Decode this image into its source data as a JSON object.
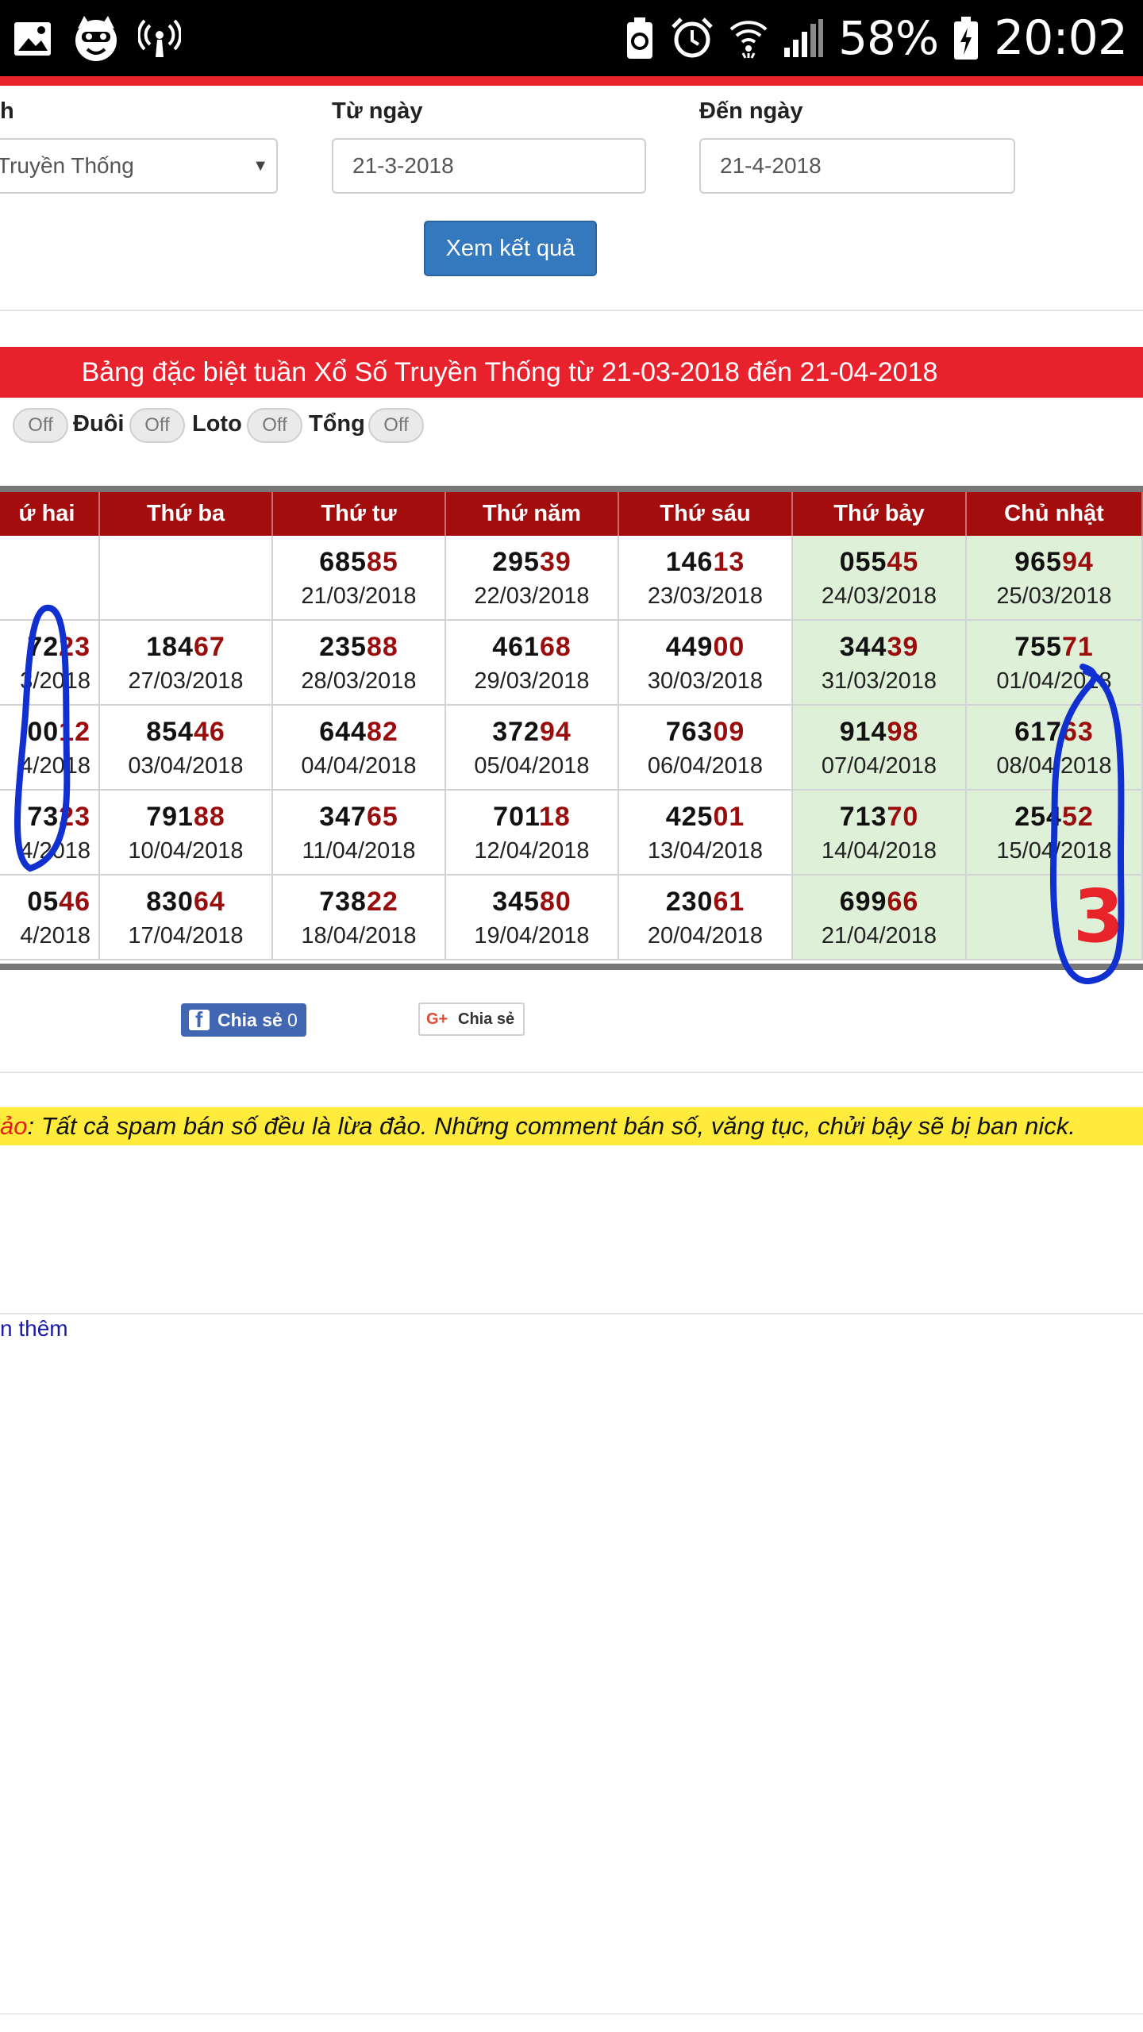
{
  "status_bar": {
    "battery_percent": "58%",
    "time": "20:02",
    "left_icons": [
      "gallery-icon",
      "cat-app-icon",
      "hotspot-icon"
    ],
    "right_icons": [
      "battery-saver-icon",
      "alarm-icon",
      "wifi-icon",
      "signal-icon",
      "battery-icon"
    ]
  },
  "form": {
    "type_label": "h",
    "type_value": "Truyền Thống",
    "from_label": "Từ ngày",
    "from_value": "21-3-2018",
    "to_label": "Đến ngày",
    "to_value": "21-4-2018",
    "submit_label": "Xem kết quả"
  },
  "banner": {
    "title": "Bảng đặc biệt tuần Xổ Số Truyền Thống từ 21-03-2018 đến 21-04-2018"
  },
  "toggles": [
    {
      "label": "",
      "state": "Off"
    },
    {
      "label": "Đuôi",
      "state": "Off"
    },
    {
      "label": "Loto",
      "state": "Off"
    },
    {
      "label": "Tổng",
      "state": "Off"
    }
  ],
  "table": {
    "headers": [
      "ứ hai",
      "Thứ ba",
      "Thứ tư",
      "Thứ năm",
      "Thứ sáu",
      "Thứ bảy",
      "Chủ nhật"
    ],
    "rows": [
      [
        {
          "head": "",
          "tail": "",
          "date": ""
        },
        {
          "head": "",
          "tail": "",
          "date": ""
        },
        {
          "head": "685",
          "tail": "85",
          "date": "21/03/2018"
        },
        {
          "head": "295",
          "tail": "39",
          "date": "22/03/2018"
        },
        {
          "head": "146",
          "tail": "13",
          "date": "23/03/2018"
        },
        {
          "head": "055",
          "tail": "45",
          "date": "24/03/2018"
        },
        {
          "head": "965",
          "tail": "94",
          "date": "25/03/2018"
        }
      ],
      [
        {
          "head": "72",
          "tail": "23",
          "date": "3/2018"
        },
        {
          "head": "184",
          "tail": "67",
          "date": "27/03/2018"
        },
        {
          "head": "235",
          "tail": "88",
          "date": "28/03/2018"
        },
        {
          "head": "461",
          "tail": "68",
          "date": "29/03/2018"
        },
        {
          "head": "449",
          "tail": "00",
          "date": "30/03/2018"
        },
        {
          "head": "344",
          "tail": "39",
          "date": "31/03/2018"
        },
        {
          "head": "755",
          "tail": "71",
          "date": "01/04/2018"
        }
      ],
      [
        {
          "head": "00",
          "tail": "12",
          "date": "4/2018"
        },
        {
          "head": "854",
          "tail": "46",
          "date": "03/04/2018"
        },
        {
          "head": "644",
          "tail": "82",
          "date": "04/04/2018"
        },
        {
          "head": "372",
          "tail": "94",
          "date": "05/04/2018"
        },
        {
          "head": "763",
          "tail": "09",
          "date": "06/04/2018"
        },
        {
          "head": "914",
          "tail": "98",
          "date": "07/04/2018"
        },
        {
          "head": "617",
          "tail": "63",
          "date": "08/04/2018"
        }
      ],
      [
        {
          "head": "73",
          "tail": "23",
          "date": "4/2018"
        },
        {
          "head": "791",
          "tail": "88",
          "date": "10/04/2018"
        },
        {
          "head": "347",
          "tail": "65",
          "date": "11/04/2018"
        },
        {
          "head": "701",
          "tail": "18",
          "date": "12/04/2018"
        },
        {
          "head": "425",
          "tail": "01",
          "date": "13/04/2018"
        },
        {
          "head": "713",
          "tail": "70",
          "date": "14/04/2018"
        },
        {
          "head": "254",
          "tail": "52",
          "date": "15/04/2018"
        }
      ],
      [
        {
          "head": "05",
          "tail": "46",
          "date": "4/2018"
        },
        {
          "head": "830",
          "tail": "64",
          "date": "17/04/2018"
        },
        {
          "head": "738",
          "tail": "22",
          "date": "18/04/2018"
        },
        {
          "head": "345",
          "tail": "80",
          "date": "19/04/2018"
        },
        {
          "head": "230",
          "tail": "61",
          "date": "20/04/2018"
        },
        {
          "head": "699",
          "tail": "66",
          "date": "21/04/2018"
        },
        {
          "head": "",
          "tail": "",
          "date": ""
        }
      ]
    ],
    "weekend_color": "#dff0d8",
    "tail_color": "#9b0d0d",
    "header_color": "#a30d0d"
  },
  "share": {
    "facebook_label": "Chia sẻ",
    "facebook_count": "0",
    "google_label": "Chia sẻ"
  },
  "notice": {
    "prefix": "ảo",
    "text": ": Tất cả spam bán số đều là lừa đảo. Những comment bán số, văng tục, chửi bậy sẽ bị ban nick."
  },
  "more_link": "n thêm",
  "annotation": {
    "handwritten_digit": "3",
    "pen_color": "#1030d0",
    "digit_color": "#e8232a"
  }
}
